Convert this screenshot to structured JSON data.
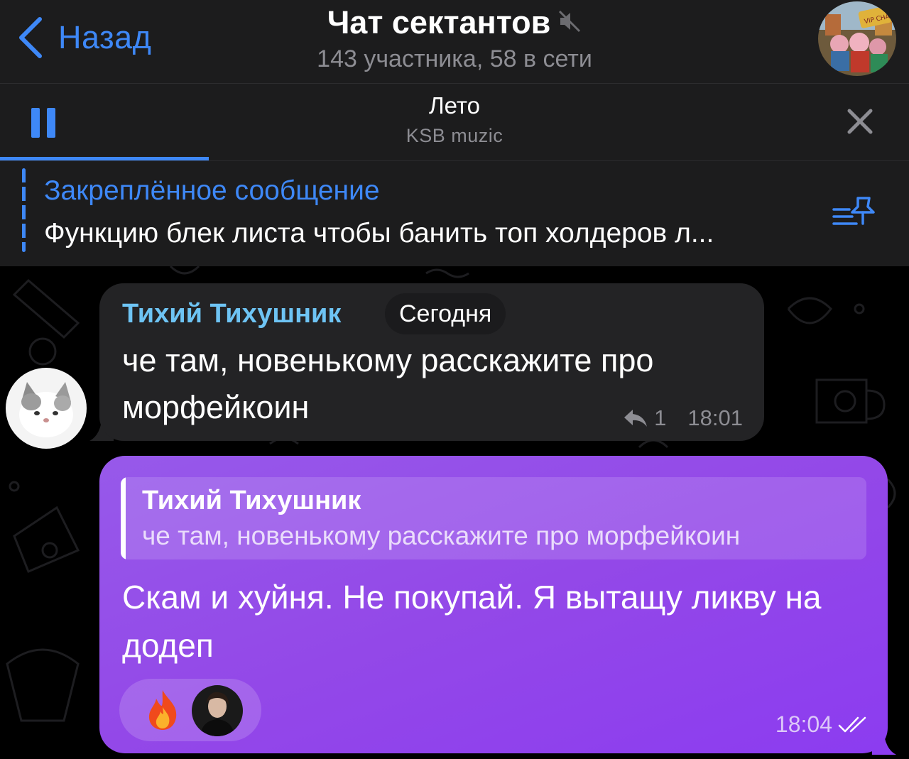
{
  "header": {
    "back_label": "Назад",
    "title": "Чат сектантов",
    "subtitle": "143 участника, 58 в сети",
    "muted_icon": "speaker-muted-icon",
    "avatar_badge": "VIP CHAT"
  },
  "player": {
    "track_title": "Лето",
    "track_artist": "KSB muzic",
    "progress": 0.23
  },
  "pinned": {
    "label": "Закреплённое сообщение",
    "text": "Функцию блек листа чтобы банить топ холдеров л..."
  },
  "messages": [
    {
      "sender": "Тихий Тихушник",
      "date_label": "Сегодня",
      "text": "че там, новенькому расскажите про морфейкоин",
      "replies": "1",
      "time": "18:01"
    },
    {
      "reply_to_name": "Тихий Тихушник",
      "reply_to_text": "че там, новенькому расскажите про морфейкоин",
      "text": "Скам и хуйня. Не покупай. Я вытащу ликву на додеп",
      "reaction_emoji": "fire-icon",
      "time": "18:04"
    }
  ],
  "colors": {
    "accent": "#3e88f7",
    "header_bg": "#1c1c1d",
    "incoming_bubble": "#232325",
    "outgoing_bubble": "#9348e8",
    "sender_name": "#6ec4f4"
  }
}
